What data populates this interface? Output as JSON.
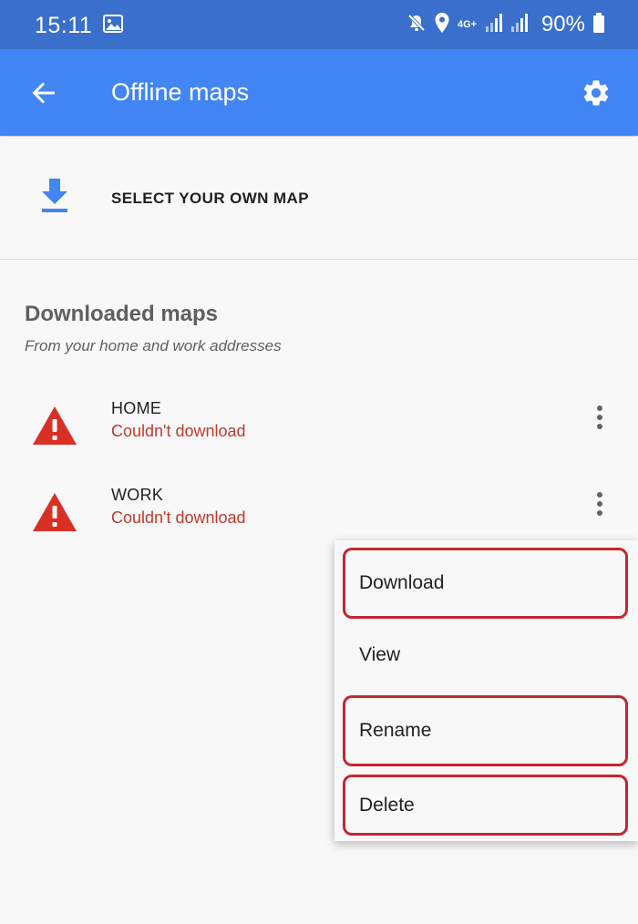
{
  "status_bar": {
    "time": "15:11",
    "network": "4G+",
    "battery": "90%",
    "icons": [
      "image-icon",
      "mute-icon",
      "location-icon",
      "signal-icon",
      "signal-icon",
      "battery-icon"
    ]
  },
  "app_bar": {
    "title": "Offline maps",
    "back_icon": "arrow-back-icon",
    "settings_icon": "gear-icon",
    "background": "#4285f4"
  },
  "select_own_map": {
    "label": "SELECT YOUR OWN MAP",
    "icon": "download-icon",
    "icon_color": "#4285f4"
  },
  "downloaded": {
    "title": "Downloaded maps",
    "subtitle": "From your home and work addresses",
    "items": [
      {
        "name": "HOME",
        "status": "Couldn't download",
        "icon": "warning-icon"
      },
      {
        "name": "WORK",
        "status": "Couldn't download",
        "icon": "warning-icon"
      }
    ],
    "status_color": "#c0392b",
    "warning_color": "#d93025"
  },
  "menu": {
    "items": [
      {
        "label": "Download",
        "highlighted": true
      },
      {
        "label": "View",
        "highlighted": false
      },
      {
        "label": "Rename",
        "highlighted": true
      },
      {
        "label": "Delete",
        "highlighted": true
      }
    ],
    "highlight_color": "#c7252f"
  }
}
